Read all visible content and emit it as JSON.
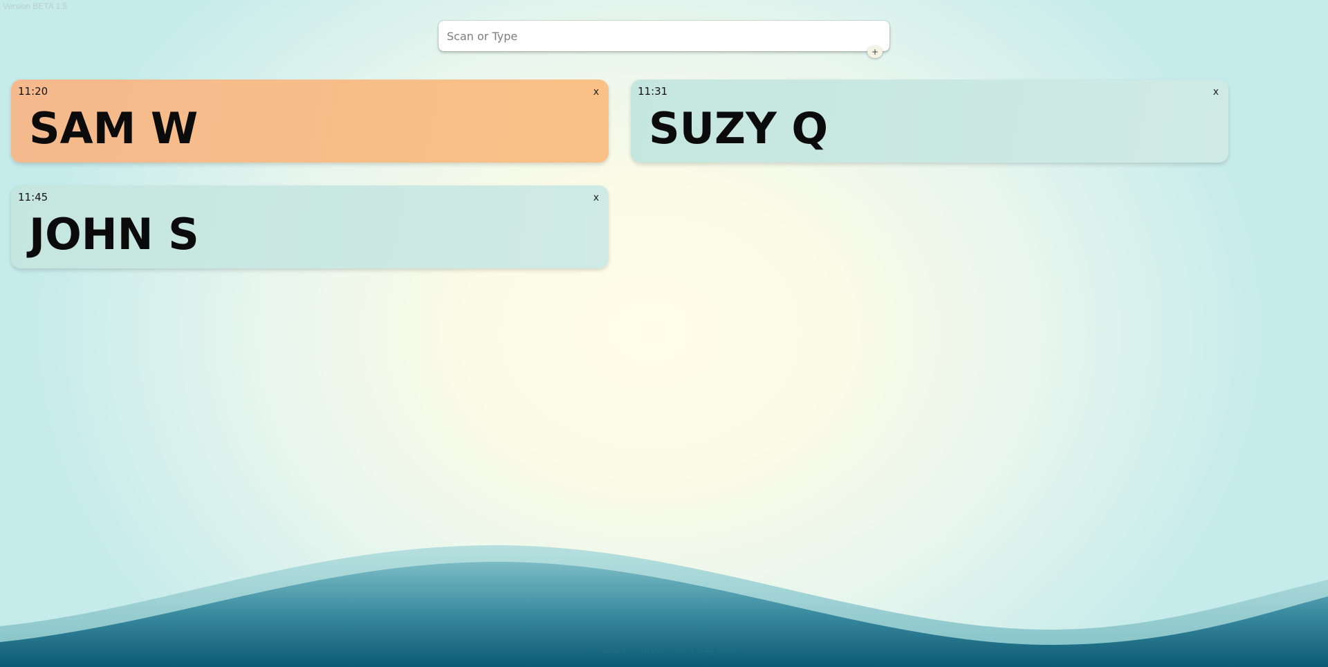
{
  "version_label": "Version BETA 1.5",
  "search": {
    "placeholder": "Scan or Type",
    "value": "",
    "add_label": "+"
  },
  "cards": [
    {
      "time": "11:20",
      "name": "SAM W",
      "close": "x",
      "color": "#f7bd8a"
    },
    {
      "time": "11:31",
      "name": "SUZY Q",
      "close": "x",
      "color": "#c9e8e1"
    },
    {
      "time": "11:45",
      "name": "JOHN S",
      "close": "x",
      "color": "#c9e8e1"
    }
  ],
  "footer": "© 2023 Andrew Park Programs",
  "colors": {
    "accent_orange": "#f7bd8a",
    "accent_teal": "#c9e8e1",
    "wave_dark": "#0c5f78",
    "wave_light": "#8fcbcf"
  }
}
